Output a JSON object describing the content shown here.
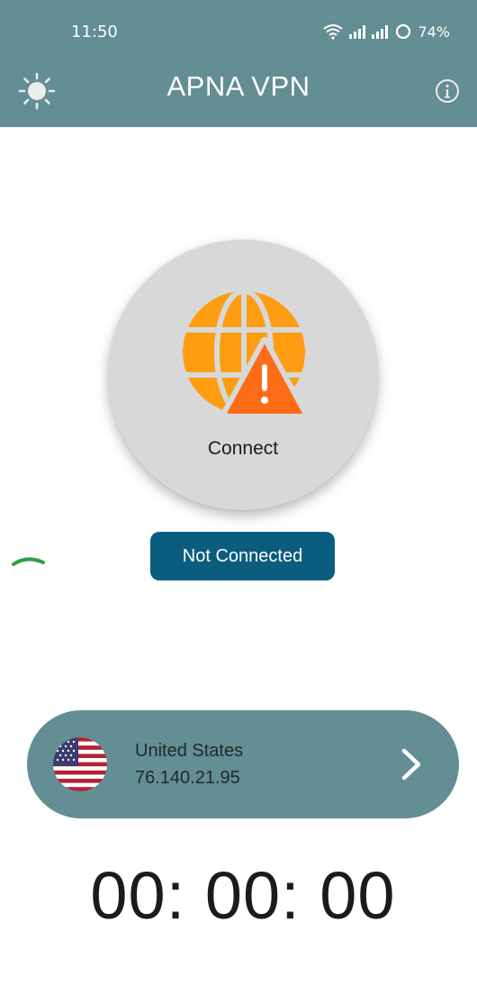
{
  "status_bar": {
    "time": "11:50",
    "battery": "74%",
    "icons": [
      "wifi-icon",
      "signal-icon",
      "signal-icon",
      "battery-ring-icon"
    ]
  },
  "header": {
    "title": "APNA VPN",
    "left_icon": "brightness-icon",
    "right_icon": "info-icon",
    "background": "#638e93"
  },
  "connect": {
    "label": "Connect",
    "icon": "globe-warning-icon",
    "colors": {
      "globe": "#fe9c12",
      "warning": "#fd6d17"
    }
  },
  "connection_status": {
    "label": "Not Connected",
    "color": "#0b5d7f"
  },
  "server": {
    "country": "United States",
    "ip": "76.140.21.95",
    "flag_icon": "us-flag-icon",
    "action_icon": "chevron-right-icon"
  },
  "timer": {
    "value": "00: 00: 00"
  }
}
